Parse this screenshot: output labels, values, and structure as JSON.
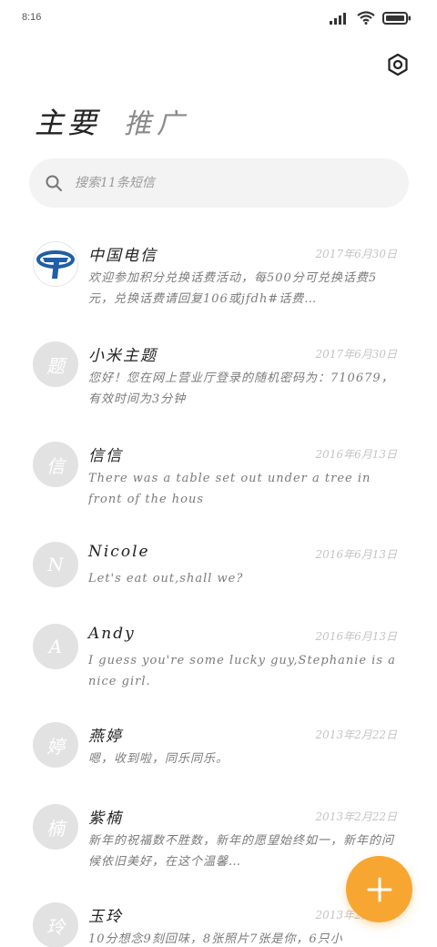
{
  "status_bar": {
    "time": "8:16",
    "icons": [
      "signal-icon",
      "wifi-icon",
      "battery-icon"
    ]
  },
  "header": {
    "title": "主要",
    "subtitle": "推广",
    "settings_icon": "settings-icon"
  },
  "search": {
    "placeholder": "搜索11条短信",
    "icon": "search-icon"
  },
  "conversations": [
    {
      "avatar": "",
      "avatar_icon": "china-telecom-logo",
      "name": "中国电信",
      "date": "2017年6月30日",
      "preview": "欢迎参加积分兑换话费活动，每500分可兑换话费5元，兑换话费请回复106或jfdh#话费…"
    },
    {
      "avatar": "题",
      "name": "小米主题",
      "date": "2017年6月30日",
      "preview": "您好！您在网上营业厅登录的随机密码为：710679，有效时间为3分钟"
    },
    {
      "avatar": "信",
      "name": "信信",
      "date": "2016年6月13日",
      "preview": "There was a table set out under a tree in front of the hous"
    },
    {
      "avatar": "N",
      "name": "Nicole",
      "date": "2016年6月13日",
      "preview": "Let's eat out,shall we?"
    },
    {
      "avatar": "A",
      "name": "Andy",
      "date": "2016年6月13日",
      "preview": "I guess you're some lucky guy,Stephanie is a nice girl."
    },
    {
      "avatar": "婷",
      "name": "燕婷",
      "date": "2013年2月22日",
      "preview": "嗯，收到啦，同乐同乐。"
    },
    {
      "avatar": "楠",
      "name": "紫楠",
      "date": "2013年2月22日",
      "preview": "新年的祝福数不胜数，新年的愿望始终如一，新年的问候依旧美好，在这个温馨…"
    },
    {
      "avatar": "玲",
      "name": "玉玲",
      "date": "2013年2月22日",
      "preview": "10分想念9刻回味，8张照片7张是你，6只小"
    }
  ],
  "fab": {
    "icon": "plus-icon"
  },
  "colors": {
    "accent": "#f7a632",
    "avatar_bg": "#e2e2e2",
    "search_bg": "#f3f3f3",
    "telecom_blue": "#1f5ea8"
  }
}
